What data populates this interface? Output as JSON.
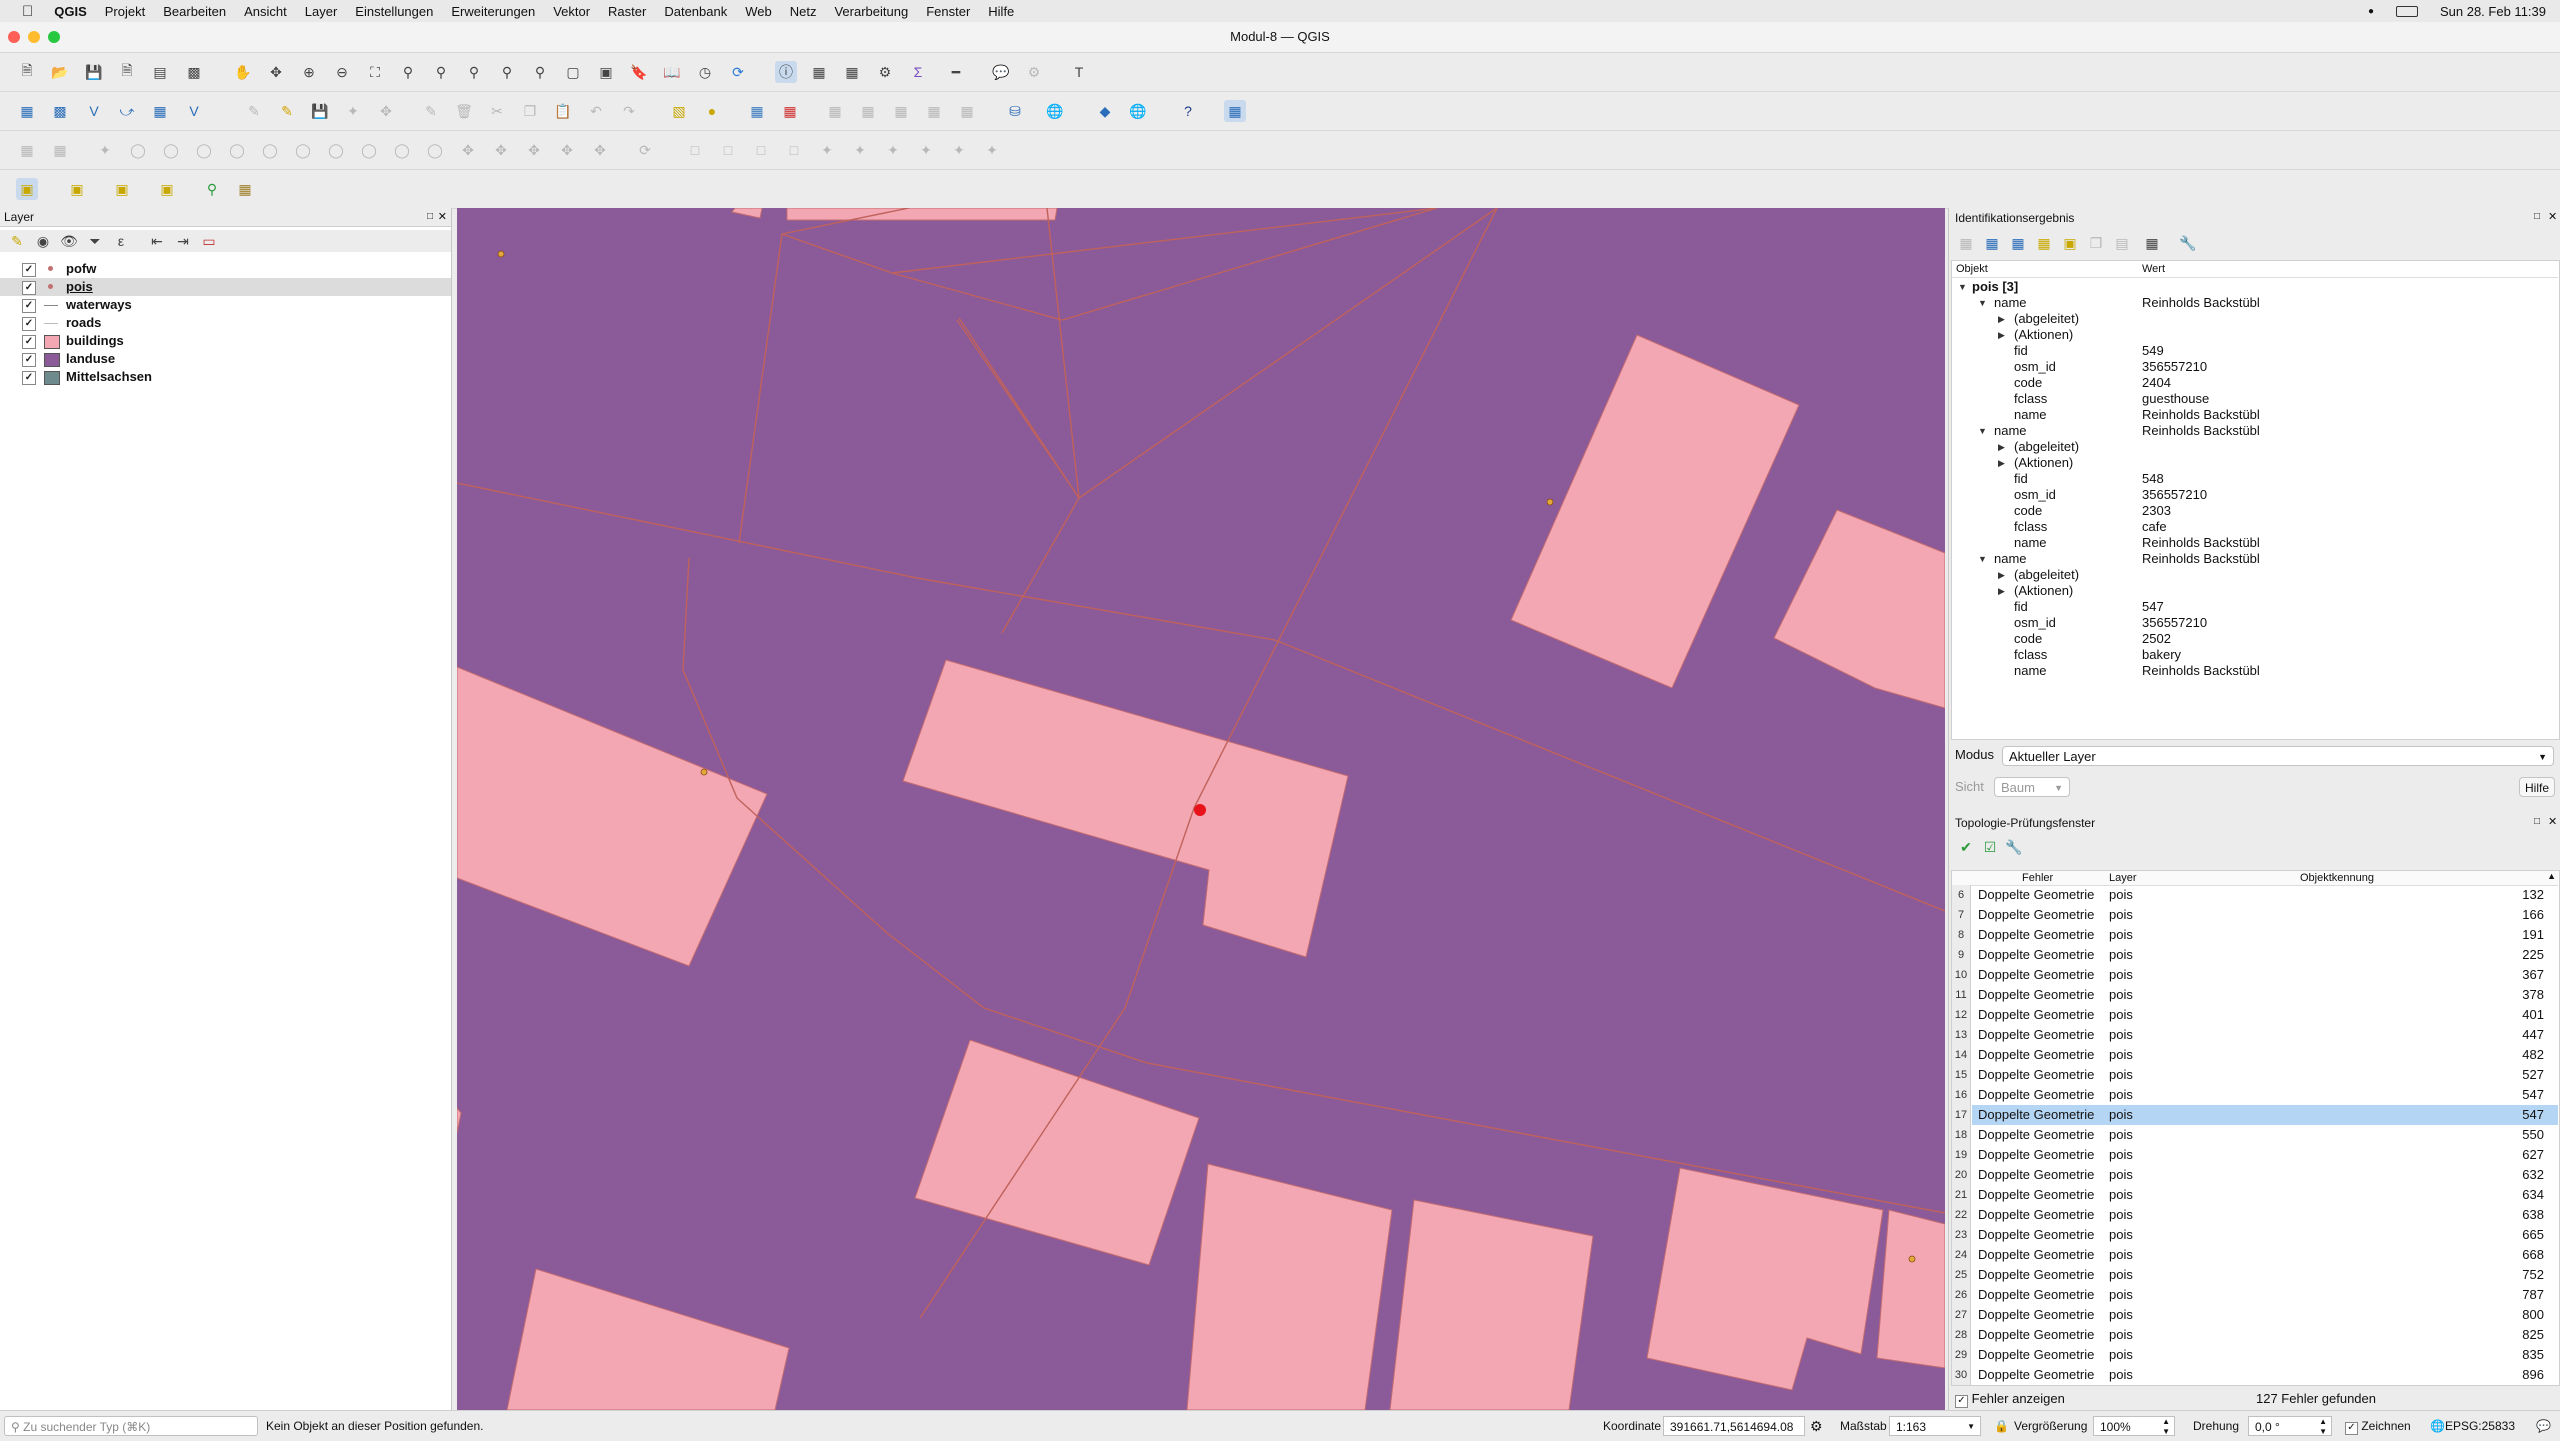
{
  "menubar": {
    "apple": "",
    "items": [
      "QGIS",
      "Projekt",
      "Bearbeiten",
      "Ansicht",
      "Layer",
      "Einstellungen",
      "Erweiterungen",
      "Vektor",
      "Raster",
      "Datenbank",
      "Web",
      "Netz",
      "Verarbeitung",
      "Fenster",
      "Hilfe"
    ],
    "clock": "Sun 28. Feb  11:39"
  },
  "window": {
    "title": "Modul-8 — QGIS"
  },
  "layers_panel": {
    "title": "Layer",
    "layers": [
      {
        "name": "pofw",
        "checked": true,
        "symbol": "point",
        "color": "#c07070"
      },
      {
        "name": "pois",
        "checked": true,
        "symbol": "point",
        "color": "#c07070",
        "selected": true
      },
      {
        "name": "waterways",
        "checked": true,
        "symbol": "line",
        "color": "#888888"
      },
      {
        "name": "roads",
        "checked": true,
        "symbol": "line",
        "color": "#bbbbbb"
      },
      {
        "name": "buildings",
        "checked": true,
        "symbol": "fill",
        "color": "#f2a7b2"
      },
      {
        "name": "landuse",
        "checked": true,
        "symbol": "fill",
        "color": "#8b5a98"
      },
      {
        "name": "Mittelsachsen",
        "checked": true,
        "symbol": "fill",
        "color": "#6e8a8c"
      }
    ]
  },
  "identify_panel": {
    "title": "Identifikationsergebnis",
    "col_object": "Objekt",
    "col_value": "Wert",
    "root": "pois [3]",
    "features": [
      {
        "name_key": "name",
        "name_val": "Reinholds Backstübl",
        "derived": "(abgeleitet)",
        "actions": "(Aktionen)",
        "attrs": [
          [
            "fid",
            "549"
          ],
          [
            "osm_id",
            "356557210"
          ],
          [
            "code",
            "2404"
          ],
          [
            "fclass",
            "guesthouse"
          ],
          [
            "name",
            "Reinholds Backstübl"
          ]
        ]
      },
      {
        "name_key": "name",
        "name_val": "Reinholds Backstübl",
        "derived": "(abgeleitet)",
        "actions": "(Aktionen)",
        "attrs": [
          [
            "fid",
            "548"
          ],
          [
            "osm_id",
            "356557210"
          ],
          [
            "code",
            "2303"
          ],
          [
            "fclass",
            "cafe"
          ],
          [
            "name",
            "Reinholds Backstübl"
          ]
        ]
      },
      {
        "name_key": "name",
        "name_val": "Reinholds Backstübl",
        "derived": "(abgeleitet)",
        "actions": "(Aktionen)",
        "attrs": [
          [
            "fid",
            "547"
          ],
          [
            "osm_id",
            "356557210"
          ],
          [
            "code",
            "2502"
          ],
          [
            "fclass",
            "bakery"
          ],
          [
            "name",
            "Reinholds Backstübl"
          ]
        ]
      }
    ],
    "mode_label": "Modus",
    "mode_value": "Aktueller Layer",
    "view_label": "Sicht",
    "view_value": "Baum",
    "help_button": "Hilfe"
  },
  "topology_panel": {
    "title": "Topologie-Prüfungsfenster",
    "columns": [
      "Fehler",
      "Layer",
      "Objektkennung"
    ],
    "rows": [
      [
        "6",
        "Doppelte Geometrie",
        "pois",
        "132"
      ],
      [
        "7",
        "Doppelte Geometrie",
        "pois",
        "166"
      ],
      [
        "8",
        "Doppelte Geometrie",
        "pois",
        "191"
      ],
      [
        "9",
        "Doppelte Geometrie",
        "pois",
        "225"
      ],
      [
        "10",
        "Doppelte Geometrie",
        "pois",
        "367"
      ],
      [
        "11",
        "Doppelte Geometrie",
        "pois",
        "378"
      ],
      [
        "12",
        "Doppelte Geometrie",
        "pois",
        "401"
      ],
      [
        "13",
        "Doppelte Geometrie",
        "pois",
        "447"
      ],
      [
        "14",
        "Doppelte Geometrie",
        "pois",
        "482"
      ],
      [
        "15",
        "Doppelte Geometrie",
        "pois",
        "527"
      ],
      [
        "16",
        "Doppelte Geometrie",
        "pois",
        "547"
      ],
      [
        "17",
        "Doppelte Geometrie",
        "pois",
        "547"
      ],
      [
        "18",
        "Doppelte Geometrie",
        "pois",
        "550"
      ],
      [
        "19",
        "Doppelte Geometrie",
        "pois",
        "627"
      ],
      [
        "20",
        "Doppelte Geometrie",
        "pois",
        "632"
      ],
      [
        "21",
        "Doppelte Geometrie",
        "pois",
        "634"
      ],
      [
        "22",
        "Doppelte Geometrie",
        "pois",
        "638"
      ],
      [
        "23",
        "Doppelte Geometrie",
        "pois",
        "665"
      ],
      [
        "24",
        "Doppelte Geometrie",
        "pois",
        "668"
      ],
      [
        "25",
        "Doppelte Geometrie",
        "pois",
        "752"
      ],
      [
        "26",
        "Doppelte Geometrie",
        "pois",
        "787"
      ],
      [
        "27",
        "Doppelte Geometrie",
        "pois",
        "800"
      ],
      [
        "28",
        "Doppelte Geometrie",
        "pois",
        "825"
      ],
      [
        "29",
        "Doppelte Geometrie",
        "pois",
        "835"
      ],
      [
        "30",
        "Doppelte Geometrie",
        "pois",
        "896"
      ]
    ],
    "selected_row": "17",
    "show_errors_label": "Fehler anzeigen",
    "error_count": "127 Fehler gefunden"
  },
  "statusbar": {
    "search_placeholder": "Zu suchender Typ (⌘K)",
    "message": "Kein Objekt an dieser Position gefunden.",
    "coord_label": "Koordinate",
    "coord_value": "391661.71,5614694.08",
    "scale_label": "Maßstab",
    "scale_value": "1:163",
    "magnifier_label": "Vergrößerung",
    "magnifier_value": "100%",
    "rotation_label": "Drehung",
    "rotation_value": "0,0 °",
    "render_label": "Zeichnen",
    "crs": "EPSG:25833"
  },
  "colors": {
    "landuse": "#8b5a98",
    "buildings": "#f2a7b2",
    "roads": "#c0625c",
    "highlight": "#b5d5f5",
    "identified_point": "#e8121b"
  }
}
